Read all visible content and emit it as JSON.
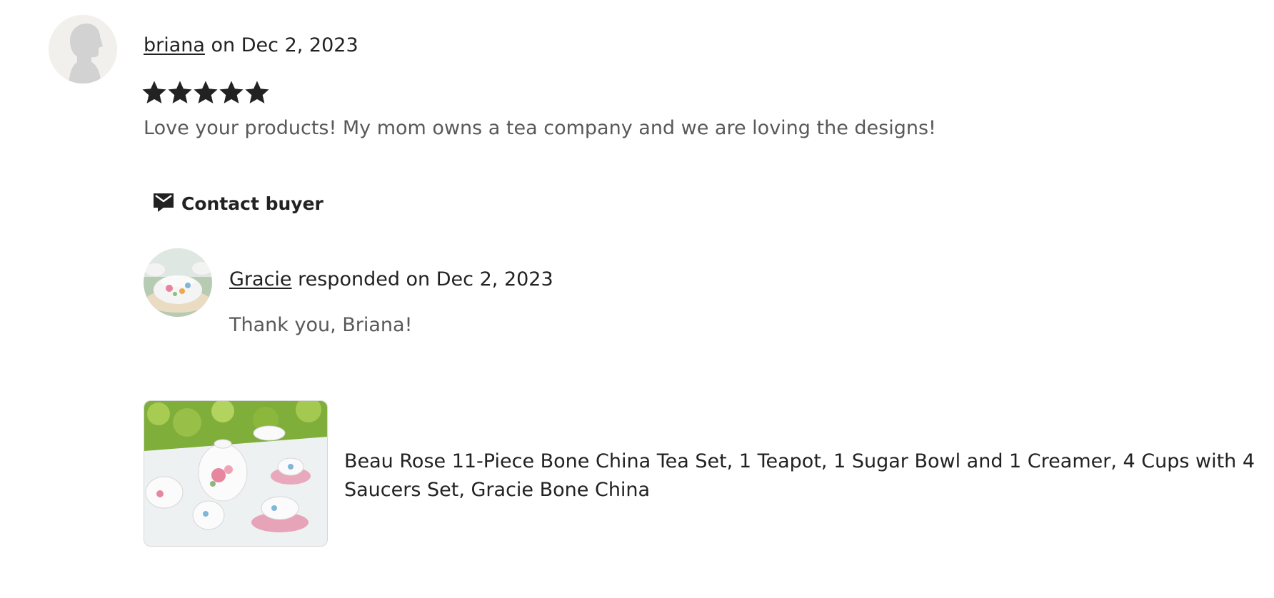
{
  "review": {
    "reviewer_name": "briana",
    "date_prefix": " on ",
    "date": "Dec 2, 2023",
    "rating": 5,
    "rating_max": 5,
    "text": "Love your products! My mom owns a tea company and we are loving the designs!"
  },
  "contact": {
    "icon": "envelope-icon",
    "label": "Contact buyer"
  },
  "response": {
    "seller_name": "Gracie",
    "responded_prefix": " responded on ",
    "date": "Dec 2, 2023",
    "text": "Thank you, Briana!"
  },
  "listing": {
    "title": "Beau Rose 11-Piece Bone China Tea Set, 1 Teapot, 1 Sugar Bowl and 1 Creamer, 4 Cups with 4 Saucers Set, Gracie Bone China"
  },
  "colors": {
    "text_primary": "#222222",
    "text_secondary": "#595959",
    "star": "#222222"
  }
}
